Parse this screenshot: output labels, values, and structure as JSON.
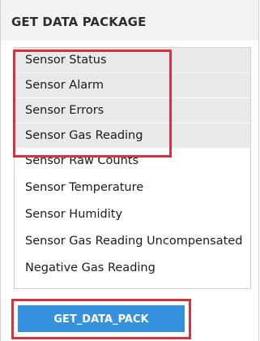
{
  "panel": {
    "title": "GET DATA PACKAGE"
  },
  "data_list": {
    "items": [
      {
        "label": "Sensor Status",
        "selected": true
      },
      {
        "label": "Sensor Alarm",
        "selected": true
      },
      {
        "label": "Sensor Errors",
        "selected": true
      },
      {
        "label": "Sensor Gas Reading",
        "selected": true
      },
      {
        "label": "Sensor Raw Counts",
        "selected": false
      },
      {
        "label": "Sensor Temperature",
        "selected": false
      },
      {
        "label": "Sensor Humidity",
        "selected": false
      },
      {
        "label": "Sensor Gas Reading Uncompensated",
        "selected": false
      },
      {
        "label": "Negative Gas Reading",
        "selected": false
      }
    ]
  },
  "actions": {
    "get_data_pack_label": "GET_DATA_PACK"
  },
  "colors": {
    "highlight_border": "#d9323f",
    "button_background": "#3590dd",
    "selected_row_background": "#e9e9e9",
    "header_background": "#f3f3f3"
  }
}
